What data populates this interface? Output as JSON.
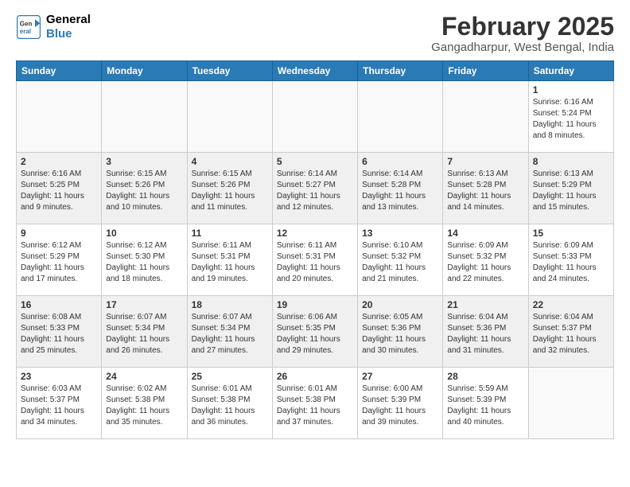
{
  "header": {
    "logo_line1": "General",
    "logo_line2": "Blue",
    "month": "February 2025",
    "location": "Gangadharpur, West Bengal, India"
  },
  "weekdays": [
    "Sunday",
    "Monday",
    "Tuesday",
    "Wednesday",
    "Thursday",
    "Friday",
    "Saturday"
  ],
  "weeks": [
    [
      {
        "day": "",
        "info": ""
      },
      {
        "day": "",
        "info": ""
      },
      {
        "day": "",
        "info": ""
      },
      {
        "day": "",
        "info": ""
      },
      {
        "day": "",
        "info": ""
      },
      {
        "day": "",
        "info": ""
      },
      {
        "day": "1",
        "info": "Sunrise: 6:16 AM\nSunset: 5:24 PM\nDaylight: 11 hours\nand 8 minutes."
      }
    ],
    [
      {
        "day": "2",
        "info": "Sunrise: 6:16 AM\nSunset: 5:25 PM\nDaylight: 11 hours\nand 9 minutes."
      },
      {
        "day": "3",
        "info": "Sunrise: 6:15 AM\nSunset: 5:26 PM\nDaylight: 11 hours\nand 10 minutes."
      },
      {
        "day": "4",
        "info": "Sunrise: 6:15 AM\nSunset: 5:26 PM\nDaylight: 11 hours\nand 11 minutes."
      },
      {
        "day": "5",
        "info": "Sunrise: 6:14 AM\nSunset: 5:27 PM\nDaylight: 11 hours\nand 12 minutes."
      },
      {
        "day": "6",
        "info": "Sunrise: 6:14 AM\nSunset: 5:28 PM\nDaylight: 11 hours\nand 13 minutes."
      },
      {
        "day": "7",
        "info": "Sunrise: 6:13 AM\nSunset: 5:28 PM\nDaylight: 11 hours\nand 14 minutes."
      },
      {
        "day": "8",
        "info": "Sunrise: 6:13 AM\nSunset: 5:29 PM\nDaylight: 11 hours\nand 15 minutes."
      }
    ],
    [
      {
        "day": "9",
        "info": "Sunrise: 6:12 AM\nSunset: 5:29 PM\nDaylight: 11 hours\nand 17 minutes."
      },
      {
        "day": "10",
        "info": "Sunrise: 6:12 AM\nSunset: 5:30 PM\nDaylight: 11 hours\nand 18 minutes."
      },
      {
        "day": "11",
        "info": "Sunrise: 6:11 AM\nSunset: 5:31 PM\nDaylight: 11 hours\nand 19 minutes."
      },
      {
        "day": "12",
        "info": "Sunrise: 6:11 AM\nSunset: 5:31 PM\nDaylight: 11 hours\nand 20 minutes."
      },
      {
        "day": "13",
        "info": "Sunrise: 6:10 AM\nSunset: 5:32 PM\nDaylight: 11 hours\nand 21 minutes."
      },
      {
        "day": "14",
        "info": "Sunrise: 6:09 AM\nSunset: 5:32 PM\nDaylight: 11 hours\nand 22 minutes."
      },
      {
        "day": "15",
        "info": "Sunrise: 6:09 AM\nSunset: 5:33 PM\nDaylight: 11 hours\nand 24 minutes."
      }
    ],
    [
      {
        "day": "16",
        "info": "Sunrise: 6:08 AM\nSunset: 5:33 PM\nDaylight: 11 hours\nand 25 minutes."
      },
      {
        "day": "17",
        "info": "Sunrise: 6:07 AM\nSunset: 5:34 PM\nDaylight: 11 hours\nand 26 minutes."
      },
      {
        "day": "18",
        "info": "Sunrise: 6:07 AM\nSunset: 5:34 PM\nDaylight: 11 hours\nand 27 minutes."
      },
      {
        "day": "19",
        "info": "Sunrise: 6:06 AM\nSunset: 5:35 PM\nDaylight: 11 hours\nand 29 minutes."
      },
      {
        "day": "20",
        "info": "Sunrise: 6:05 AM\nSunset: 5:36 PM\nDaylight: 11 hours\nand 30 minutes."
      },
      {
        "day": "21",
        "info": "Sunrise: 6:04 AM\nSunset: 5:36 PM\nDaylight: 11 hours\nand 31 minutes."
      },
      {
        "day": "22",
        "info": "Sunrise: 6:04 AM\nSunset: 5:37 PM\nDaylight: 11 hours\nand 32 minutes."
      }
    ],
    [
      {
        "day": "23",
        "info": "Sunrise: 6:03 AM\nSunset: 5:37 PM\nDaylight: 11 hours\nand 34 minutes."
      },
      {
        "day": "24",
        "info": "Sunrise: 6:02 AM\nSunset: 5:38 PM\nDaylight: 11 hours\nand 35 minutes."
      },
      {
        "day": "25",
        "info": "Sunrise: 6:01 AM\nSunset: 5:38 PM\nDaylight: 11 hours\nand 36 minutes."
      },
      {
        "day": "26",
        "info": "Sunrise: 6:01 AM\nSunset: 5:38 PM\nDaylight: 11 hours\nand 37 minutes."
      },
      {
        "day": "27",
        "info": "Sunrise: 6:00 AM\nSunset: 5:39 PM\nDaylight: 11 hours\nand 39 minutes."
      },
      {
        "day": "28",
        "info": "Sunrise: 5:59 AM\nSunset: 5:39 PM\nDaylight: 11 hours\nand 40 minutes."
      },
      {
        "day": "",
        "info": ""
      }
    ]
  ]
}
